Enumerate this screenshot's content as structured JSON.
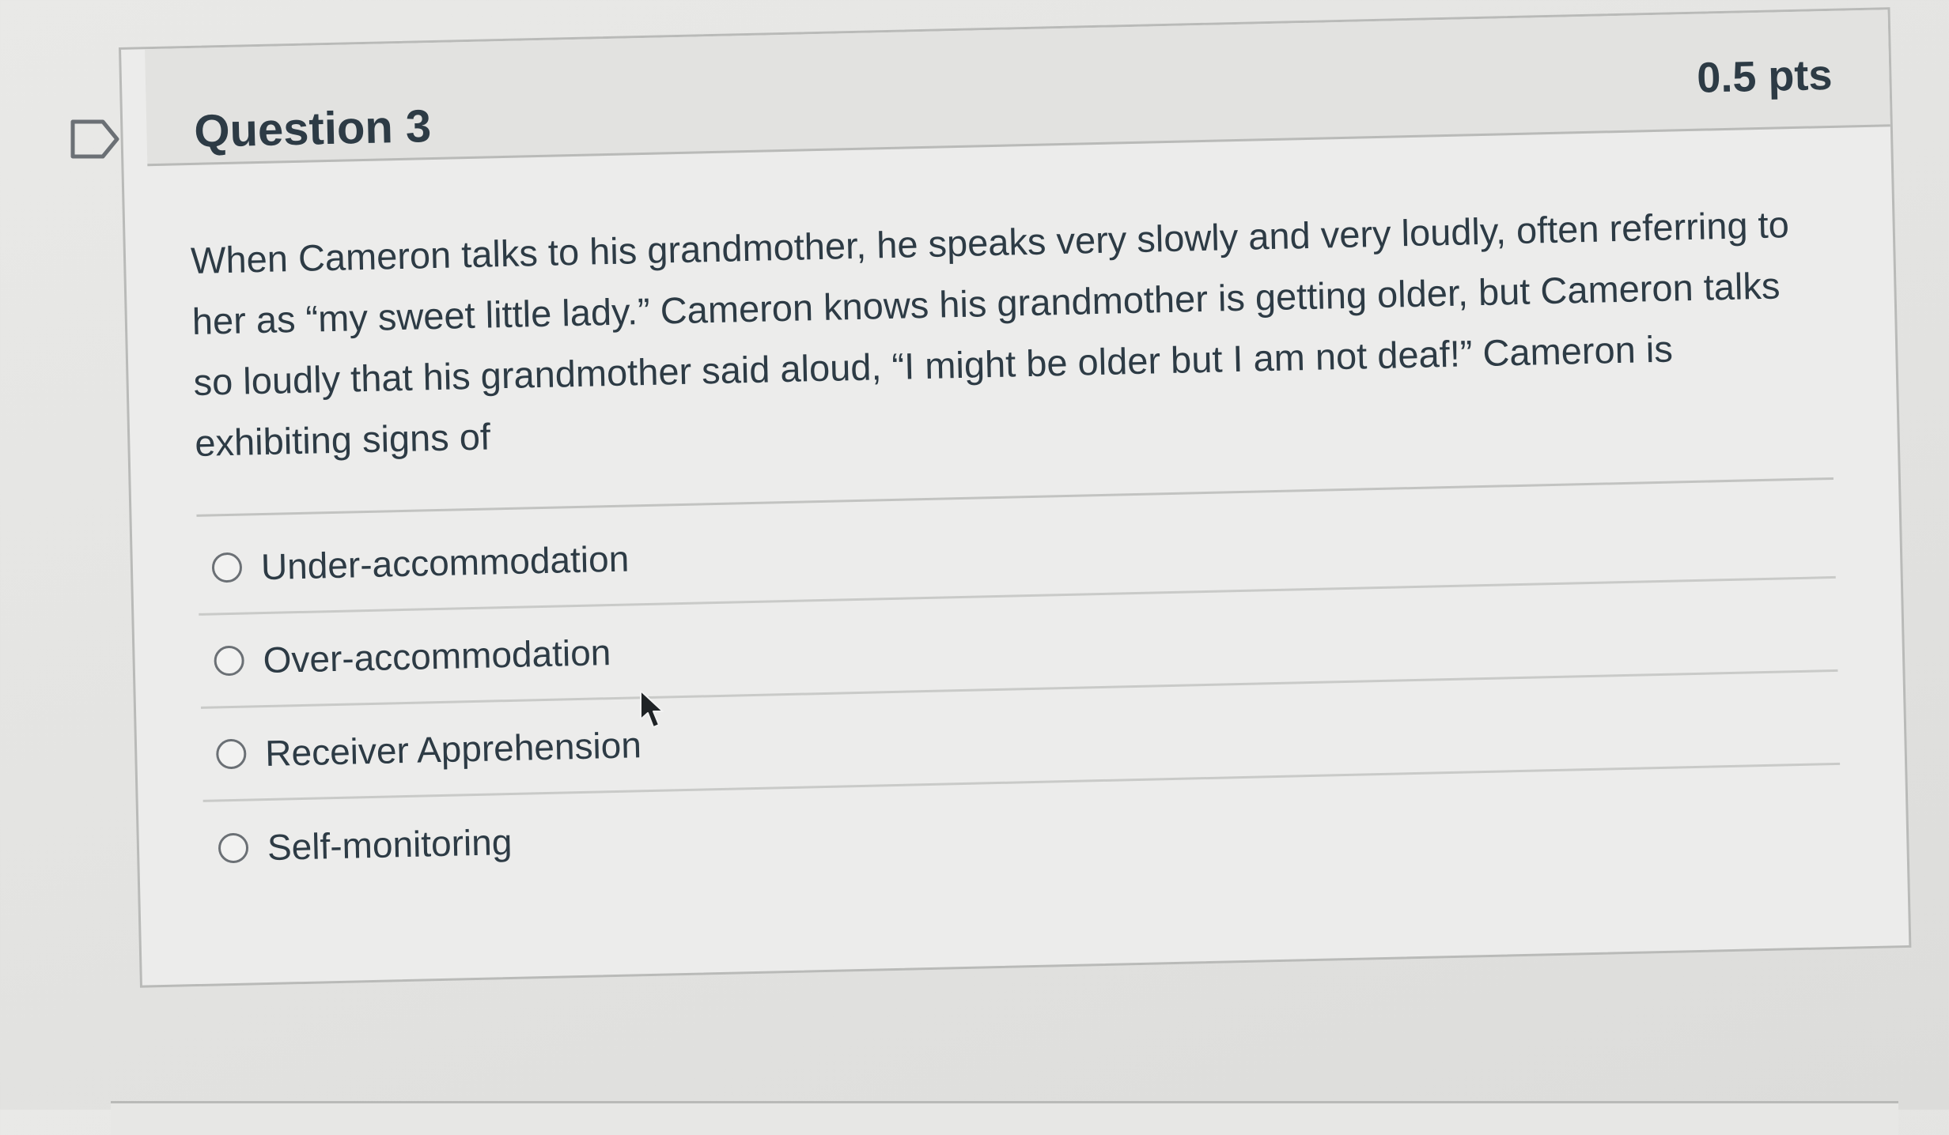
{
  "question": {
    "title": "Question 3",
    "points": "0.5 pts",
    "text": "When Cameron talks to his grandmother, he speaks very slowly and very loudly, often referring to her as “my sweet little lady.” Cameron knows his grandmother is getting older, but Cameron talks so loudly that his grandmother said aloud, “I might be older but I am not deaf!” Cameron is exhibiting signs of",
    "flag_icon": "flag-question-icon",
    "answers": [
      {
        "label": "Under-accommodation",
        "selected": false
      },
      {
        "label": "Over-accommodation",
        "selected": false
      },
      {
        "label": "Receiver Apprehension",
        "selected": false
      },
      {
        "label": "Self-monitoring",
        "selected": false
      }
    ]
  },
  "colors": {
    "text": "#2d3b45",
    "border": "#b9bab8",
    "header_bg": "#e2e2e0"
  }
}
